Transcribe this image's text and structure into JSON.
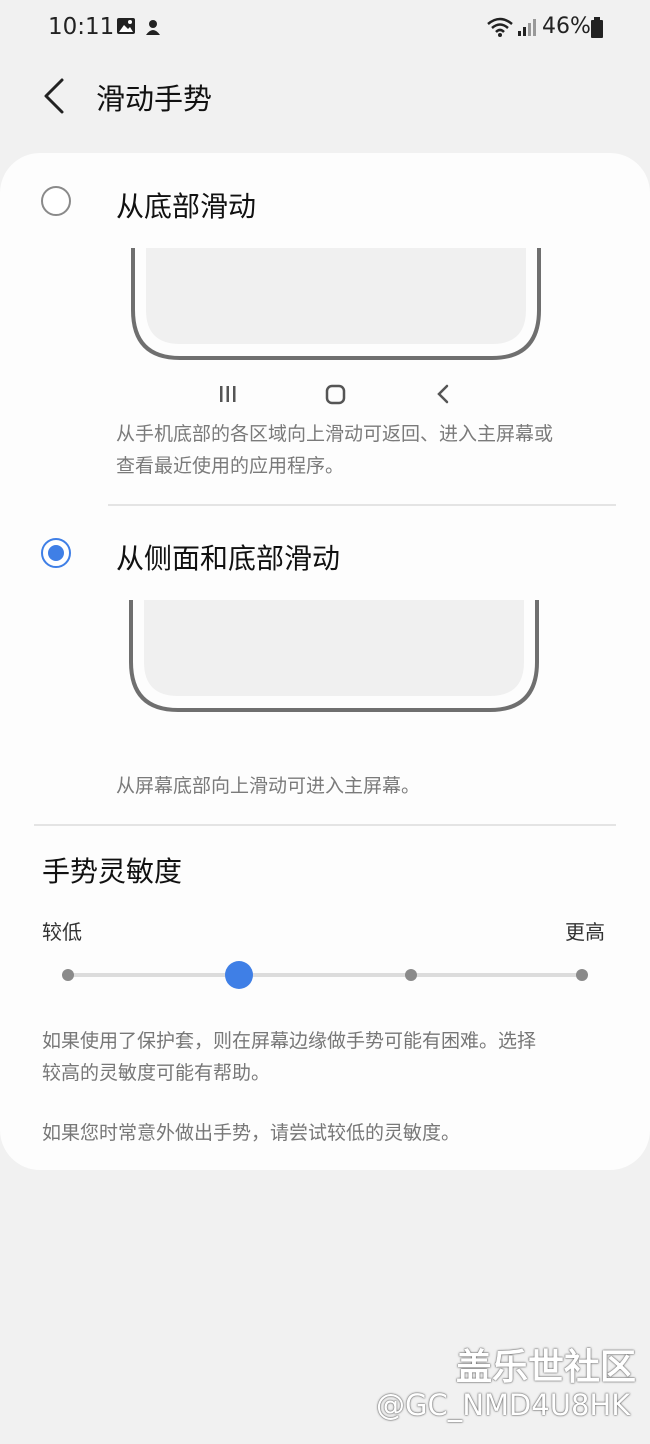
{
  "status_bar": {
    "time": "10:11",
    "battery": "46%"
  },
  "header": {
    "title": "滑动手势"
  },
  "options": [
    {
      "label": "从底部滑动",
      "selected": false,
      "description_lines": [
        "从手机底部的各区域向上滑动可返回、进入主屏幕或",
        "查看最近使用的应用程序。"
      ]
    },
    {
      "label": "从侧面和底部滑动",
      "selected": true,
      "description_lines": [
        "从屏幕底部向上滑动可进入主屏幕。"
      ]
    }
  ],
  "sensitivity": {
    "title": "手势灵敏度",
    "low_label": "较低",
    "high_label": "更高",
    "levels": 4,
    "selected_level": 2,
    "note1_lines": [
      "如果使用了保护套，则在屏幕边缘做手势可能有困难。选择",
      "较高的灵敏度可能有帮助。"
    ],
    "note2_lines": [
      "如果您时常意外做出手势，请尝试较低的灵敏度。"
    ]
  },
  "watermark": {
    "brand": "盖乐世社区",
    "user": "@GC_NMD4U8HK"
  },
  "colors": {
    "accent": "#3f7fe6",
    "card": "#fdfdfd",
    "background": "#f1f1f1"
  }
}
